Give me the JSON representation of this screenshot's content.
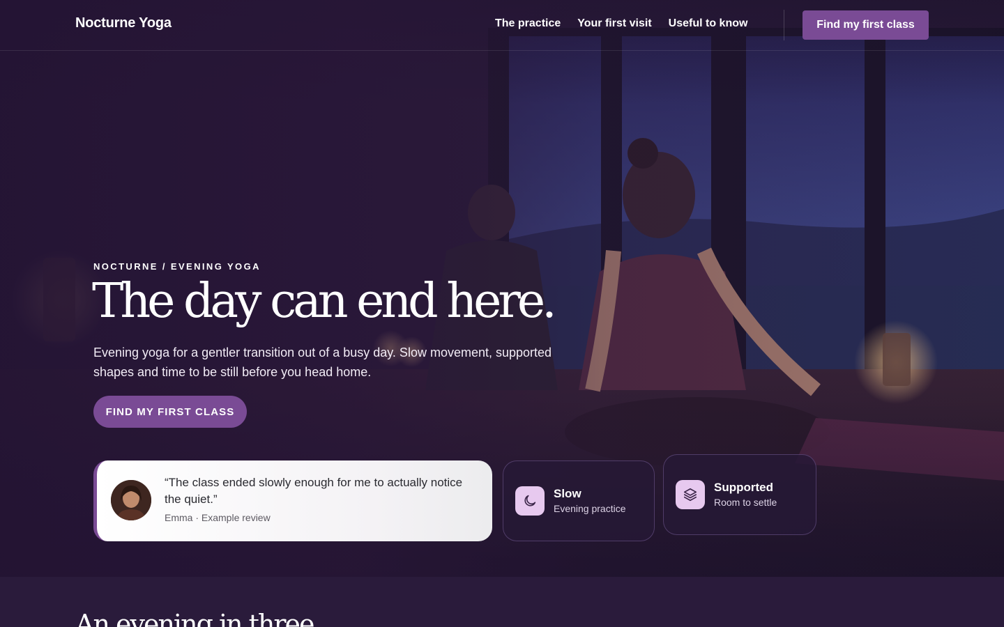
{
  "nav": {
    "brand": "Nocturne Yoga",
    "links": [
      "The practice",
      "Your first visit",
      "Useful to know"
    ],
    "cta": "Find my first class"
  },
  "hero": {
    "eyebrow": "NOCTURNE / EVENING YOGA",
    "headline": "The day can end here.",
    "lede": "Evening yoga for a gentler transition out of a busy day. Slow movement, supported shapes and time to be still before you head home.",
    "cta": "FIND MY FIRST CLASS"
  },
  "review": {
    "quote": "“The class ended slowly enough for me to actually notice the quiet.”",
    "attribution": "Emma · Example review"
  },
  "features": [
    {
      "title": "Slow",
      "subtitle": "Evening practice",
      "icon": "moon-icon"
    },
    {
      "title": "Supported",
      "subtitle": "Room to settle",
      "icon": "layers-icon"
    }
  ],
  "next_section": {
    "title": "An evening in three"
  },
  "colors": {
    "accent": "#7a4b95",
    "background": "#2a1b3b",
    "icon_tile": "#e7c9ef"
  }
}
